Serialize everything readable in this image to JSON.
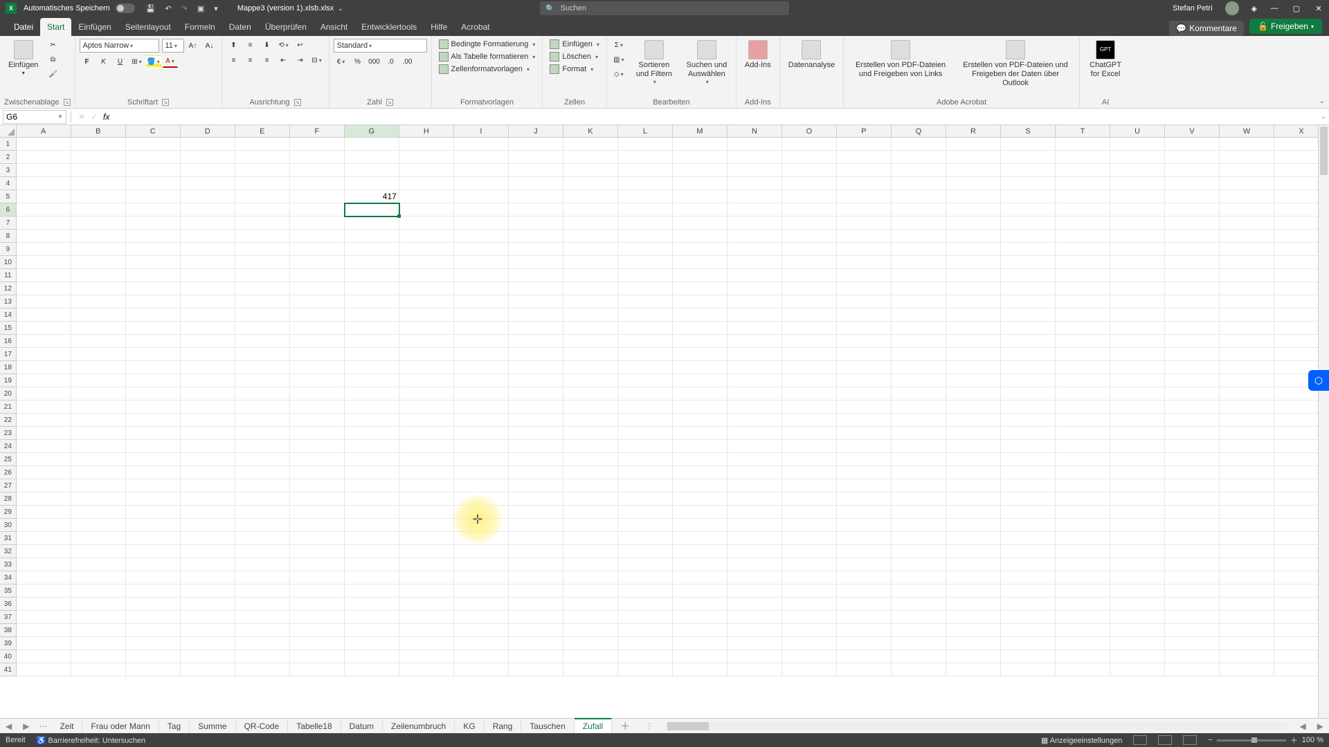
{
  "title": {
    "autosave": "Automatisches Speichern",
    "docname": "Mappe3 (version 1).xlsb.xlsx",
    "search_ph": "Suchen",
    "user": "Stefan Petri"
  },
  "tabs": {
    "file": "Datei",
    "items": [
      "Start",
      "Einfügen",
      "Seitenlayout",
      "Formeln",
      "Daten",
      "Überprüfen",
      "Ansicht",
      "Entwicklertools",
      "Hilfe",
      "Acrobat"
    ],
    "comments": "Kommentare",
    "share": "Freigeben"
  },
  "ribbon": {
    "paste": "Einfügen",
    "clipboard": "Zwischenablage",
    "fontname": "Aptos Narrow",
    "fontsize": "11",
    "fontgroup": "Schriftart",
    "align": "Ausrichtung",
    "numfmt": "Standard",
    "numgroup": "Zahl",
    "cond": "Bedingte Formatierung",
    "table": "Als Tabelle formatieren",
    "cellstyles": "Zellenformatvorlagen",
    "stylesgroup": "Formatvorlagen",
    "insert": "Einfügen",
    "delete": "Löschen",
    "format": "Format",
    "cellsgroup": "Zellen",
    "sortfilter": "Sortieren und Filtern",
    "findselect": "Suchen und Auswählen",
    "editgroup": "Bearbeiten",
    "addins": "Add-Ins",
    "addinsgroup": "Add-Ins",
    "datan": "Datenanalyse",
    "pdf1": "Erstellen von PDF-Dateien und Freigeben von Links",
    "pdf2": "Erstellen von PDF-Dateien und Freigeben der Daten über Outlook",
    "acro": "Adobe Acrobat",
    "gpt": "ChatGPT for Excel",
    "ai": "AI"
  },
  "formula": {
    "namebox": "G6",
    "value": ""
  },
  "cols": [
    "A",
    "B",
    "C",
    "D",
    "E",
    "F",
    "G",
    "H",
    "I",
    "J",
    "K",
    "L",
    "M",
    "N",
    "O",
    "P",
    "Q",
    "R",
    "S",
    "T",
    "U",
    "V",
    "W",
    "X"
  ],
  "rowcount": 41,
  "active": {
    "col": "G",
    "row": 6
  },
  "cells": {
    "G5": "417"
  },
  "sheets": [
    "Zeit",
    "Frau oder Mann",
    "Tag",
    "Summe",
    "QR-Code",
    "Tabelle18",
    "Datum",
    "Zeilenumbruch",
    "KG",
    "Rang",
    "Tauschen",
    "Zufall"
  ],
  "active_sheet": 11,
  "status": {
    "ready": "Bereit",
    "access": "Barrierefreiheit: Untersuchen",
    "display": "Anzeigeeinstellungen",
    "zoom": "100 %"
  }
}
